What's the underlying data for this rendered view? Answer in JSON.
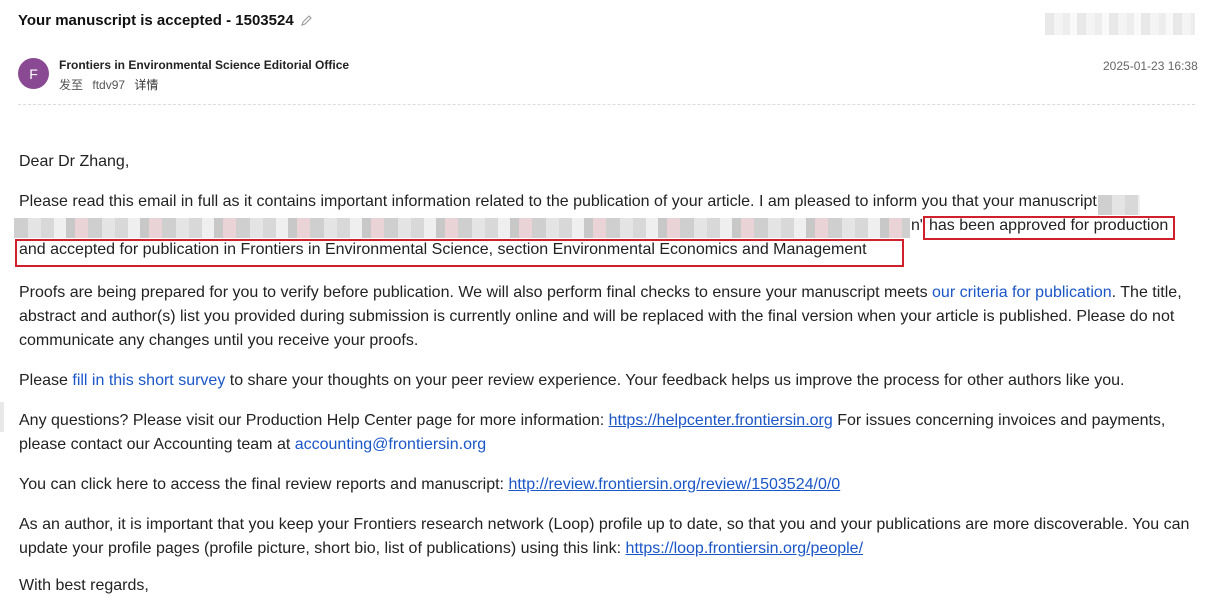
{
  "email": {
    "subject": "Your manuscript is accepted - 1503524",
    "sender": {
      "avatar_letter": "F",
      "name": "Frontiers in Environmental Science Editorial Office",
      "sent_to_label": "发至",
      "recipient": "ftdv97",
      "details_label": "详情"
    },
    "timestamp": "2025-01-23 16:38"
  },
  "body": {
    "greeting": "Dear Dr Zhang,",
    "p1_line1": "Please read this email in full as it contains important information related to the publication of your article. I am pleased to inform you that your manuscript",
    "p1_line2_tail": "n\"",
    "p1_highlight_a": "has been approved for production",
    "p1_highlight_b": "and accepted for publication in Frontiers in Environmental Science, section Environmental Economics and Management",
    "p2_a": "Proofs are being prepared for you to verify before publication. We will also perform final checks to ensure your manuscript meets ",
    "p2_link": "our criteria for publication",
    "p2_b": ". The title, abstract and author(s) list you provided during submission is currently online and will be replaced with the final version when your article is published. Please do not communicate any changes until you receive your proofs.",
    "p3_a": "Please ",
    "p3_link": "fill in this short survey",
    "p3_b": " to share your thoughts on your peer review experience. Your feedback helps us improve the process for other authors like you.",
    "p4_a": "Any questions? Please visit our Production Help Center page for more information: ",
    "p4_link1": "https://helpcenter.frontiersin.org",
    "p4_b": " For issues concerning invoices and payments, please contact our Accounting team at ",
    "p4_link2": "accounting@frontiersin.org",
    "p5_a": "You can click here to access the final review reports and manuscript: ",
    "p5_link": "http://review.frontiersin.org/review/1503524/0/0",
    "p6_a": "As an author, it is important that you keep your Frontiers research network (Loop) profile up to date, so that you and your publications are more discoverable. You can update your profile pages (profile picture, short bio, list of publications) using this link: ",
    "p6_link": "https://loop.frontiersin.org/people/",
    "closing": "With best regards,"
  },
  "colors": {
    "link": "#1a56c8",
    "highlight_box": "#d0202c",
    "avatar": "#8a4a93"
  }
}
